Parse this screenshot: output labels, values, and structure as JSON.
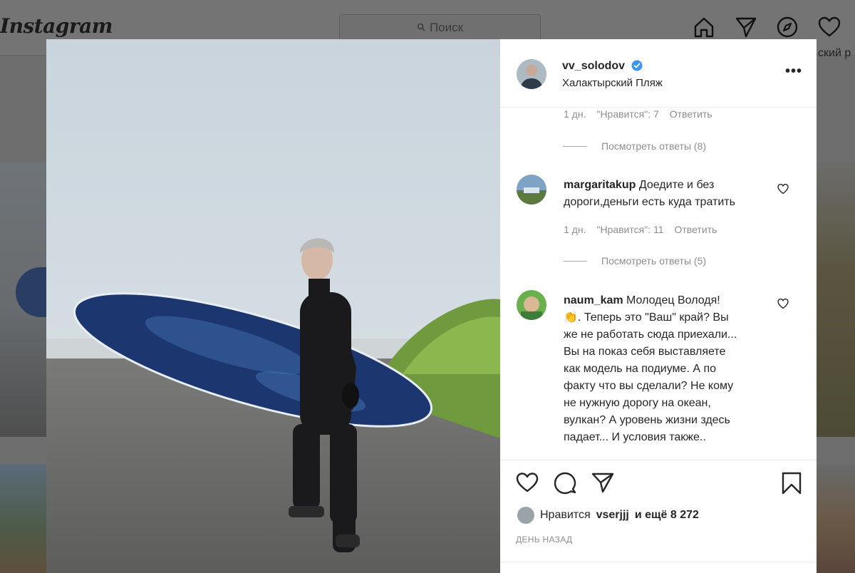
{
  "topbar": {
    "logo": "Instagram",
    "search_placeholder": "Поиск",
    "right_peek_text": "ский р"
  },
  "post": {
    "author": "vv_solodov",
    "verified": true,
    "location": "Халактырский Пляж",
    "more_label": "•••"
  },
  "comments": [
    {
      "meta": {
        "age": "1 дн.",
        "likes": "\"Нравится\": 7",
        "reply": "Ответить"
      },
      "view_replies": "Посмотреть ответы (8)"
    },
    {
      "user": "margaritakup",
      "text_line1": "Доедите и без",
      "text_line2": "дороги,деньги есть куда тратить",
      "meta": {
        "age": "1 дн.",
        "likes": "\"Нравится\": 11",
        "reply": "Ответить"
      },
      "view_replies": "Посмотреть ответы (5)"
    },
    {
      "user": "naum_kam",
      "lines": [
        "Молодец Володя!",
        "👏. Теперь это \"Ваш\" край? Вы",
        "же не работать сюда приехали...",
        "Вы на показ себя выставляете",
        "как модель на подиуме. А по",
        "факту что вы сделали? Не кому",
        "не нужную дорогу на океан,",
        "вулкан? А уровень жизни здесь",
        "падает... И условия также.."
      ]
    }
  ],
  "footer": {
    "likes_prefix": "Нравится",
    "likes_user": "vserjjj",
    "likes_suffix": "и ещё 8 272",
    "time_ago": "ДЕНЬ НАЗАД"
  },
  "colors": {
    "text": "#262626",
    "muted": "#8e8e8e",
    "verified_blue": "#3897f0",
    "overlay": "#6e6e6e"
  }
}
